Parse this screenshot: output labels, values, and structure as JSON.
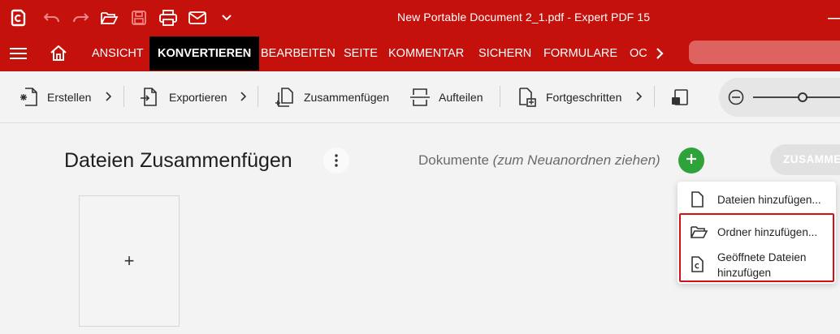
{
  "window": {
    "title": "New Portable Document 2_1.pdf   -   Expert PDF 15"
  },
  "menu": {
    "tabs": [
      {
        "label": "ANSICHT"
      },
      {
        "label": "KONVERTIEREN",
        "active": true
      },
      {
        "label": "BEARBEITEN"
      },
      {
        "label": "SEITE"
      },
      {
        "label": "KOMMENTAR"
      },
      {
        "label": "SICHERN"
      },
      {
        "label": "FORMULARE"
      },
      {
        "label": "OC"
      }
    ]
  },
  "toolbar": {
    "create_label": "Erstellen",
    "export_label": "Exportieren",
    "merge_label": "Zusammenfügen",
    "split_label": "Aufteilen",
    "advanced_label": "Fortgeschritten"
  },
  "main": {
    "title": "Dateien Zusammenfügen",
    "documents_label": "Dokumente",
    "documents_hint": "(zum Neuanordnen ziehen)",
    "merge_button_label": "ZUSAMME",
    "drop_card_symbol": "+"
  },
  "dropdown": {
    "items": [
      {
        "label": "Dateien hinzufügen...",
        "icon": "file-icon"
      },
      {
        "label": "Ordner hinzufügen...",
        "icon": "folder-open-icon"
      },
      {
        "label": "Geöffnete Dateien hinzufügen",
        "line1": "Geöffnete Dateien",
        "line2": "hinzufügen",
        "icon": "open-document-icon"
      }
    ]
  },
  "colors": {
    "brand_red": "#c5110c",
    "active_tab": "#000000",
    "add_green": "#2ea33a",
    "highlight_border": "#d30f15"
  }
}
